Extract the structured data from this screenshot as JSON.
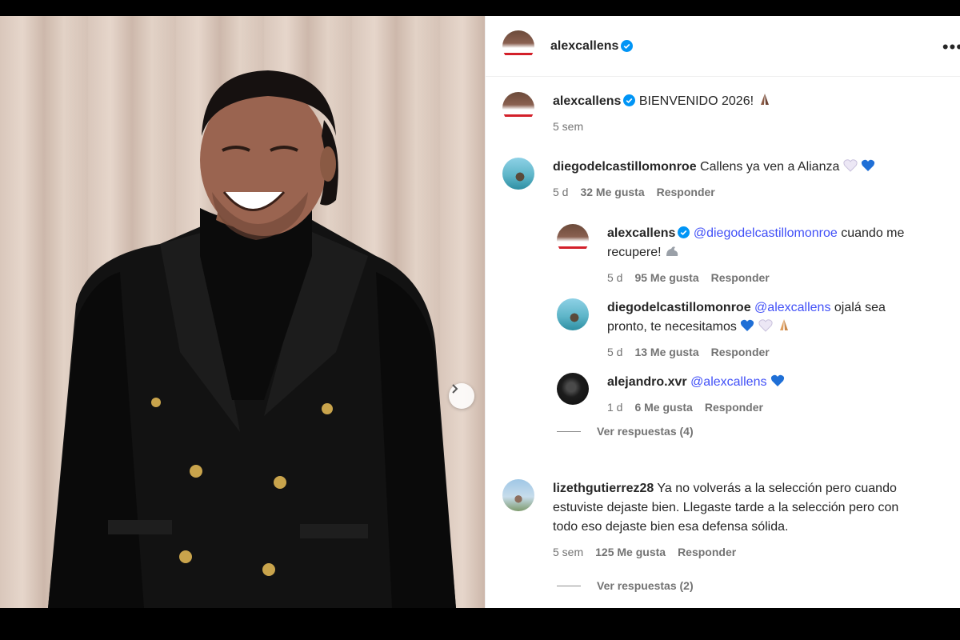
{
  "post": {
    "owner": "alexcallens",
    "caption": "BIENVENIDO 2026!",
    "caption_emoji": "pray-icon",
    "time": "5 sem"
  },
  "comments": [
    {
      "user": "diegodelcastillomonroe",
      "text": "Callens ya ven a Alianza",
      "time": "5 d",
      "likes": "32 Me gusta",
      "reply": "Responder",
      "replies": [
        {
          "user": "alexcallens",
          "mention": "@diegodelcastillomonroe",
          "text_line1": "cuando me",
          "text_line2": "recupere!",
          "time": "5 d",
          "likes": "95 Me gusta",
          "reply": "Responder"
        },
        {
          "user": "diegodelcastillomonroe",
          "mention": "@alexcallens",
          "text_line1": "ojalá sea",
          "text_line2": "pronto, te necesitamos",
          "time": "5 d",
          "likes": "13 Me gusta",
          "reply": "Responder"
        },
        {
          "user": "alejandro.xvr",
          "mention": "@alexcallens",
          "text_line1": "",
          "text_line2": "",
          "time": "1 d",
          "likes": "6 Me gusta",
          "reply": "Responder"
        }
      ],
      "view_replies": "Ver respuestas (4)"
    },
    {
      "user": "lizethgutierrez28",
      "text_line1": "Ya no volverás a la selección pero cuando",
      "text_line2": "estuviste dejaste bien. Llegaste tarde a la selección pero con",
      "text_line3": "todo eso dejaste bien esa defensa sólida.",
      "time": "5 sem",
      "likes": "125 Me gusta",
      "reply": "Responder",
      "view_replies": "Ver respuestas (2)"
    }
  ],
  "colors": {
    "mention": "#4150f7",
    "verified": "#0095f6",
    "muted": "#737373"
  }
}
